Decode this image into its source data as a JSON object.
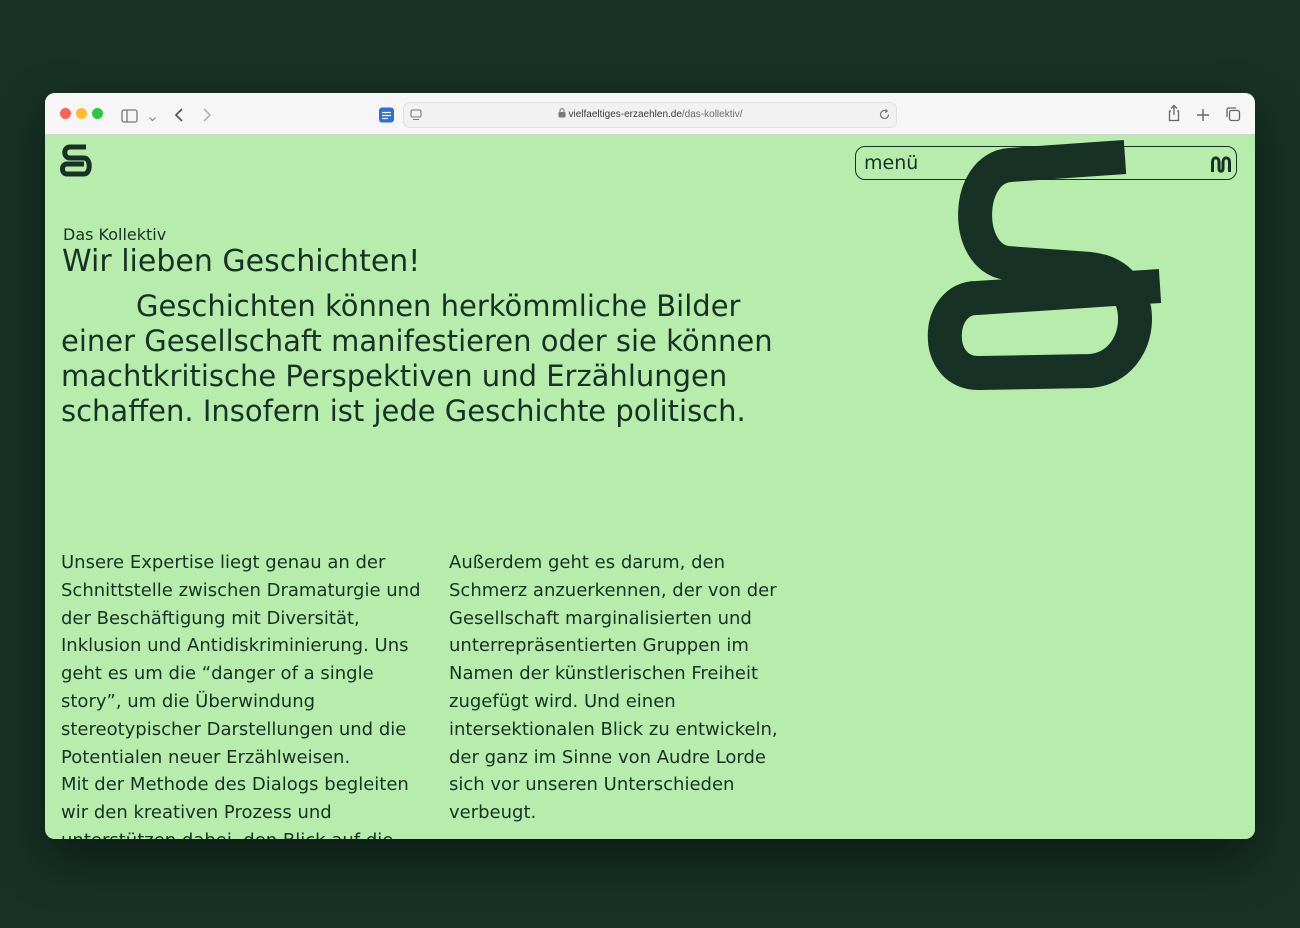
{
  "browser": {
    "url_domain": "vielfaeltiges-erzaehlen.de",
    "url_path": "/das-kollektiv/"
  },
  "header": {
    "menu_label": "menü"
  },
  "main": {
    "kicker": "Das Kollektiv",
    "title": "Wir lieben Geschichten!",
    "lead": "Geschichten können herkömmliche Bilder einer Gesellschaft manifestieren oder sie können machtkritische Perspektiven und Erzählungen schaffen. Insofern ist jede Geschichte politisch.",
    "col_left": [
      "Unsere Expertise liegt genau an der Schnittstelle zwischen Dramaturgie und der Beschäftigung mit Diversität, Inklusion und Antidiskriminierung. Uns geht es um die “danger of a single story”, um die Überwindung stereotypischer Darstellungen und die Potentialen neuer Erzählweisen.",
      "Mit der Methode des Dialogs begleiten wir den kreativen Prozess und unterstützen dabei, den Blick auf die"
    ],
    "col_right": [
      "Außerdem geht es darum, den Schmerz anzuerkennen, der von der Gesellschaft marginalisierten und unterrepräsentierten Gruppen im Namen der künstlerischen Freiheit zugefügt wird. Und einen intersektionalen Blick zu entwickeln, der ganz im Sinne von Audre Lorde sich vor unseren Unterschieden verbeugt."
    ]
  },
  "colors": {
    "background": "#b8ecad",
    "ink": "#173224",
    "desktop": "#173224"
  },
  "icons": [
    "sidebar-icon",
    "chevron-down-icon",
    "back-icon",
    "forward-icon",
    "reader-icon",
    "page-menu-icon",
    "lock-icon",
    "reload-icon",
    "share-icon",
    "plus-icon",
    "tabs-icon",
    "logo-icon",
    "menu-logo-icon",
    "squiggle-graphic"
  ]
}
